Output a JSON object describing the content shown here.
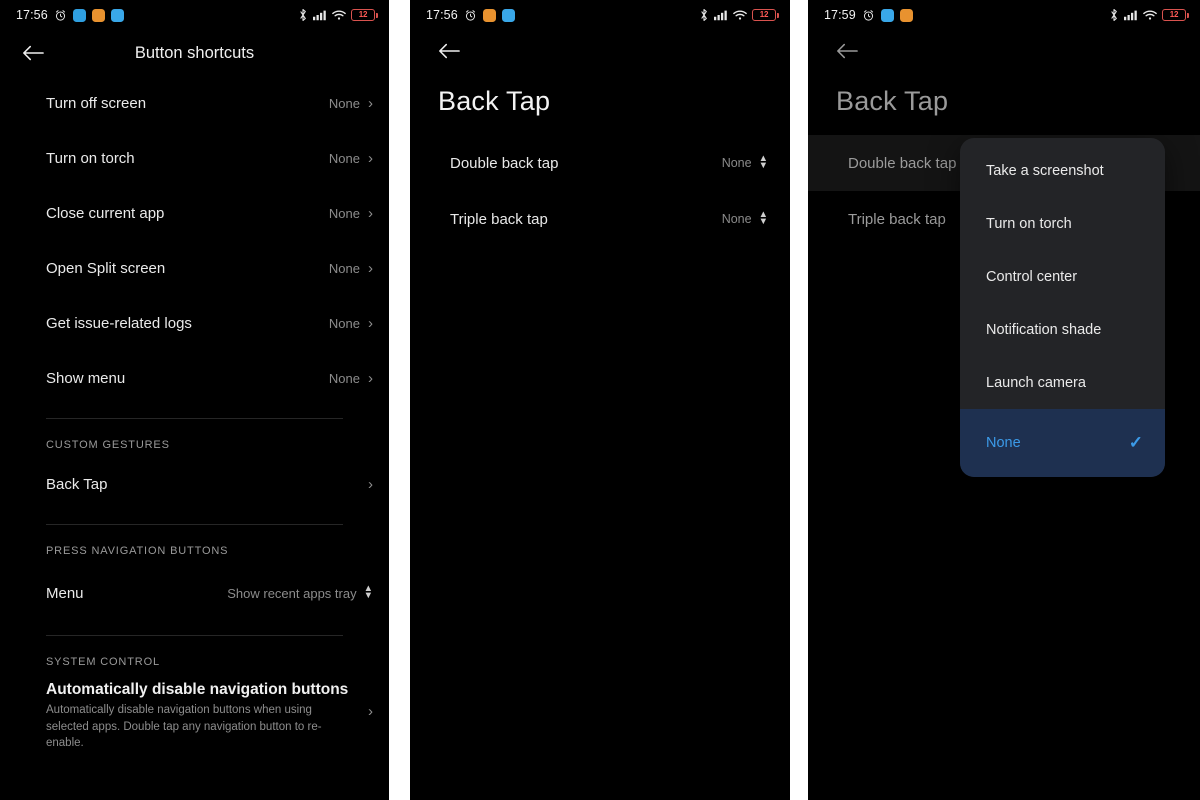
{
  "panel1": {
    "statusbar": {
      "time": "17:56",
      "icons": [
        "alarm-icon",
        "gallery-app-icon",
        "orange-app-icon",
        "telegram-app-icon"
      ],
      "right_icons": [
        "bluetooth-icon",
        "signal-icon",
        "wifi-icon"
      ],
      "battery_level": "12"
    },
    "appbar": {
      "title": "Button shortcuts",
      "back": "back-arrow"
    },
    "shortcuts": [
      {
        "label": "Turn off screen",
        "value": "None"
      },
      {
        "label": "Turn on torch",
        "value": "None"
      },
      {
        "label": "Close current app",
        "value": "None"
      },
      {
        "label": "Open Split screen",
        "value": "None"
      },
      {
        "label": "Get issue-related logs",
        "value": "None"
      },
      {
        "label": "Show menu",
        "value": "None"
      }
    ],
    "custom_gestures": {
      "header": "CUSTOM GESTURES",
      "items": [
        {
          "label": "Back Tap"
        }
      ]
    },
    "press_navigation": {
      "header": "PRESS NAVIGATION BUTTONS",
      "items": [
        {
          "label": "Menu",
          "value": "Show recent apps tray"
        }
      ]
    },
    "system_control": {
      "header": "SYSTEM CONTROL",
      "title": "Automatically disable navigation buttons",
      "subtitle": "Automatically disable navigation buttons when using selected apps. Double tap any navigation button to re-enable."
    }
  },
  "panel2": {
    "statusbar": {
      "time": "17:56",
      "battery_level": "12"
    },
    "title": "Back Tap",
    "rows": [
      {
        "label": "Double back tap",
        "value": "None"
      },
      {
        "label": "Triple back tap",
        "value": "None"
      }
    ]
  },
  "panel3": {
    "statusbar": {
      "time": "17:59",
      "battery_level": "12"
    },
    "title": "Back Tap",
    "rows": [
      {
        "label": "Double back tap"
      },
      {
        "label": "Triple back tap"
      }
    ],
    "dropdown": {
      "options": [
        {
          "label": "Take a screenshot",
          "selected": false
        },
        {
          "label": "Turn on torch",
          "selected": false
        },
        {
          "label": "Control center",
          "selected": false
        },
        {
          "label": "Notification shade",
          "selected": false
        },
        {
          "label": "Launch camera",
          "selected": false
        },
        {
          "label": "None",
          "selected": true
        }
      ],
      "check_icon": "✓"
    }
  },
  "colors": {
    "background": "#000000",
    "accent_blue": "#3b9ae8",
    "selected_row": "#1e3050",
    "menu_background": "#232427",
    "battery_low": "#ff5a55"
  }
}
